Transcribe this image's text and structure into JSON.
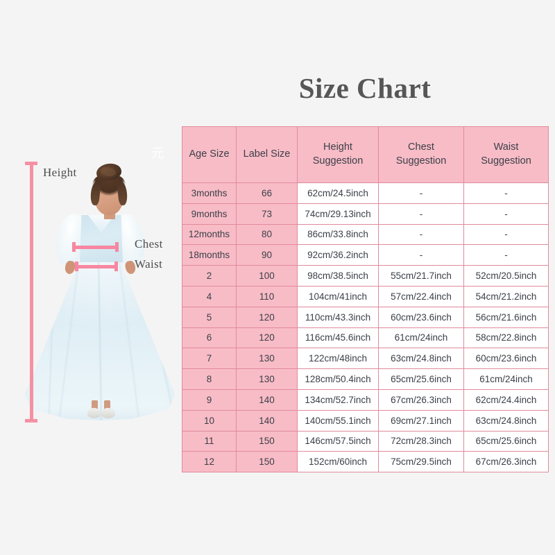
{
  "title": "Size Chart",
  "watermark": "元",
  "measurement_guide": {
    "height_label": "Height",
    "chest_label": "Chest",
    "waist_label": "Waist"
  },
  "colors": {
    "background": "#f4f4f4",
    "header_pink": "#f8bcc7",
    "border_pink": "#e08a9b",
    "ruler_pink": "#f590a3",
    "title_gray": "#565656",
    "cell_text": "#3a3f47"
  },
  "table": {
    "headers": [
      "Age Size",
      "Label Size",
      "Height Suggestion",
      "Chest Suggestion",
      "Waist Suggestion"
    ],
    "headers_split": [
      [
        "Age Size"
      ],
      [
        "Label Size"
      ],
      [
        "Height",
        "Suggestion"
      ],
      [
        "Chest",
        "Suggestion"
      ],
      [
        "Waist",
        "Suggestion"
      ]
    ],
    "rows": [
      {
        "age": "3months",
        "label": "66",
        "height": "62cm/24.5inch",
        "chest": "-",
        "waist": "-"
      },
      {
        "age": "9months",
        "label": "73",
        "height": "74cm/29.13inch",
        "chest": "-",
        "waist": "-"
      },
      {
        "age": "12months",
        "label": "80",
        "height": "86cm/33.8inch",
        "chest": "-",
        "waist": "-"
      },
      {
        "age": "18months",
        "label": "90",
        "height": "92cm/36.2inch",
        "chest": "-",
        "waist": "-"
      },
      {
        "age": "2",
        "label": "100",
        "height": "98cm/38.5inch",
        "chest": "55cm/21.7inch",
        "waist": "52cm/20.5inch"
      },
      {
        "age": "4",
        "label": "110",
        "height": "104cm/41inch",
        "chest": "57cm/22.4inch",
        "waist": "54cm/21.2inch"
      },
      {
        "age": "5",
        "label": "120",
        "height": "110cm/43.3inch",
        "chest": "60cm/23.6inch",
        "waist": "56cm/21.6inch"
      },
      {
        "age": "6",
        "label": "120",
        "height": "116cm/45.6inch",
        "chest": "61cm/24inch",
        "waist": "58cm/22.8inch"
      },
      {
        "age": "7",
        "label": "130",
        "height": "122cm/48inch",
        "chest": "63cm/24.8inch",
        "waist": "60cm/23.6inch"
      },
      {
        "age": "8",
        "label": "130",
        "height": "128cm/50.4inch",
        "chest": "65cm/25.6inch",
        "waist": "61cm/24inch"
      },
      {
        "age": "9",
        "label": "140",
        "height": "134cm/52.7inch",
        "chest": "67cm/26.3inch",
        "waist": "62cm/24.4inch"
      },
      {
        "age": "10",
        "label": "140",
        "height": "140cm/55.1inch",
        "chest": "69cm/27.1inch",
        "waist": "63cm/24.8inch"
      },
      {
        "age": "11",
        "label": "150",
        "height": "146cm/57.5inch",
        "chest": "72cm/28.3inch",
        "waist": "65cm/25.6inch"
      },
      {
        "age": "12",
        "label": "150",
        "height": "152cm/60inch",
        "chest": "75cm/29.5inch",
        "waist": "67cm/26.3inch"
      }
    ]
  }
}
